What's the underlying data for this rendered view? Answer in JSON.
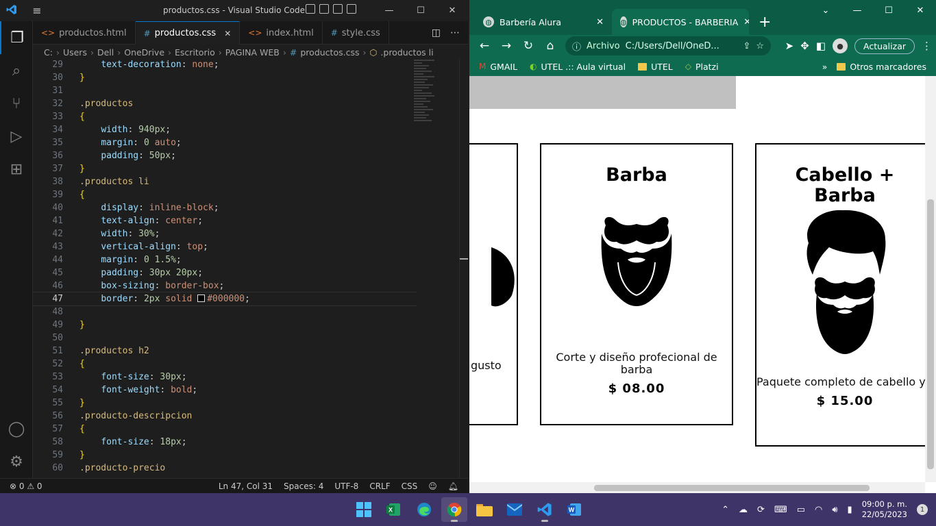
{
  "vscode": {
    "title": "productos.css - Visual Studio Code",
    "tabs": [
      {
        "label": "productos.html",
        "icon": "<>",
        "active": false
      },
      {
        "label": "productos.css",
        "icon": "#",
        "active": true
      },
      {
        "label": "index.html",
        "icon": "<>",
        "active": false
      },
      {
        "label": "style.css",
        "icon": "#",
        "active": false
      }
    ],
    "breadcrumbs": [
      "C:",
      "Users",
      "Dell",
      "OneDrive",
      "Escritorio",
      "PAGINA WEB",
      "productos.css",
      ".productos li"
    ],
    "current_line": 47,
    "status": {
      "errors": "0",
      "warnings": "0",
      "position": "Ln 47, Col 31",
      "spaces": "Spaces: 4",
      "encoding": "UTF-8",
      "eol": "CRLF",
      "language": "CSS"
    }
  },
  "browser": {
    "tabs": [
      {
        "label": "Barbería Alura",
        "active": false
      },
      {
        "label": "PRODUCTOS - BARBERIA",
        "active": true
      }
    ],
    "address_prefix": "Archivo",
    "address": "C:/Users/Dell/OneD...",
    "update_label": "Actualizar",
    "bookmarks": [
      "GMAIL",
      "UTEL .:: Aula virtual",
      "UTEL",
      "Platzi"
    ],
    "other_bookmarks": "Otros marcadores",
    "cards": [
      {
        "title": "",
        "desc": "gusto",
        "price": ""
      },
      {
        "title": "Barba",
        "desc": "Corte y diseño profecional de barba",
        "price": "$ 08.00"
      },
      {
        "title": "Cabello + Barba",
        "desc": "Paquete completo de cabello y barba",
        "price": "$ 15.00"
      }
    ]
  },
  "taskbar": {
    "time": "09:00 p. m.",
    "date": "22/05/2023",
    "notifications": "1"
  }
}
